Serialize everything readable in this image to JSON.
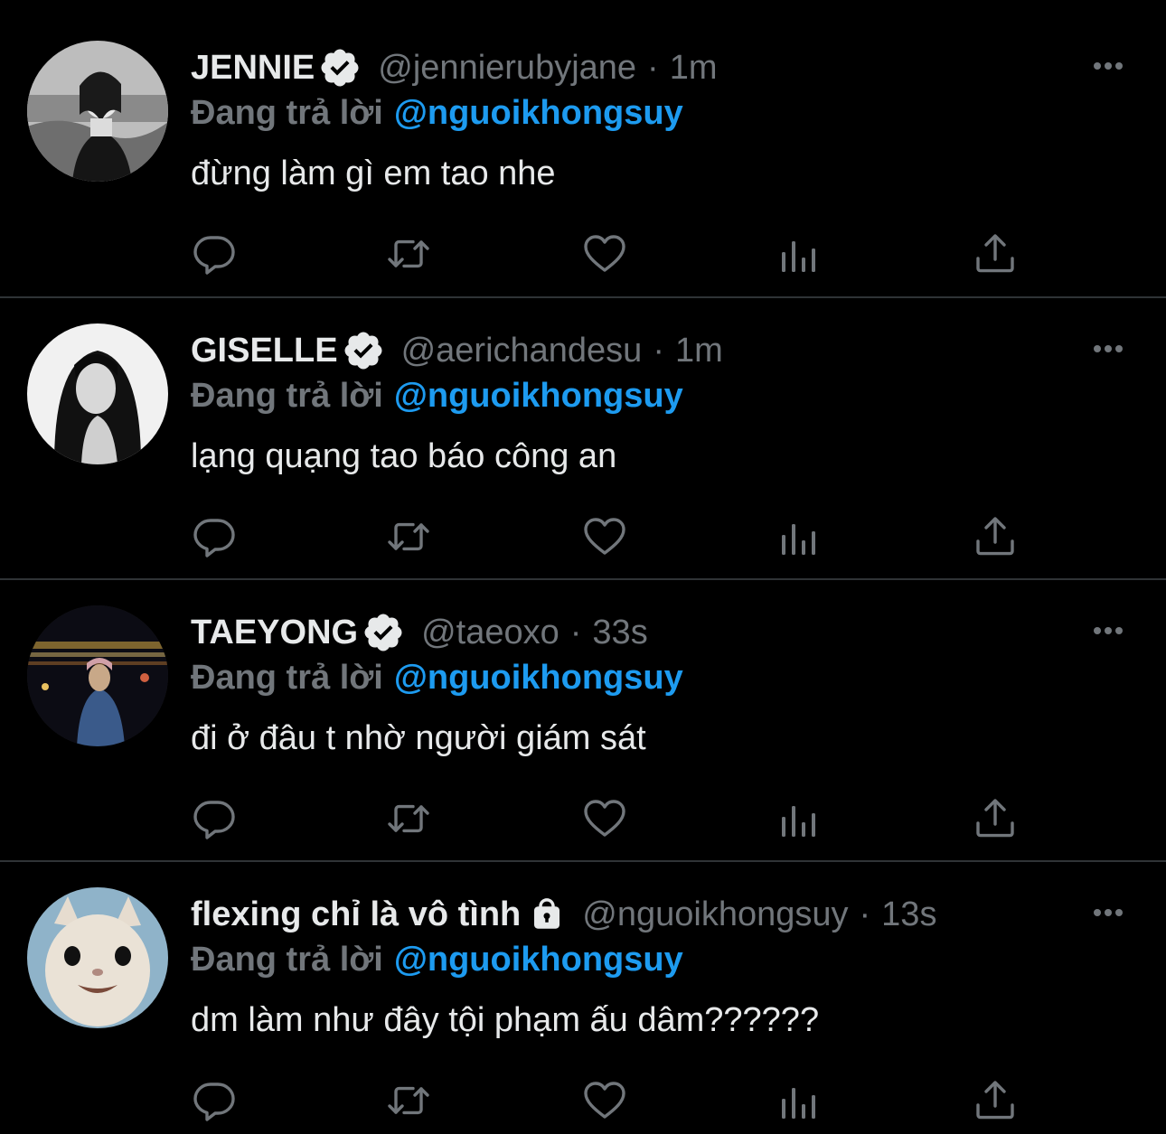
{
  "colors": {
    "background": "#000000",
    "primary_text": "#e7e9ea",
    "secondary_text": "#71767b",
    "mention": "#1d9bf0",
    "divider": "#2f3336",
    "verified_badge": "#e7e9ea"
  },
  "icons": {
    "reply": "reply-icon",
    "retweet": "retweet-icon",
    "like": "heart-icon",
    "views": "analytics-icon",
    "share": "share-icon",
    "more": "more-icon",
    "verified": "verified-icon",
    "protected": "lock-icon"
  },
  "tweets": [
    {
      "name": "JENNIE",
      "verified": true,
      "handle": "@jennierubyjane",
      "separator": "·",
      "time": "1m",
      "replying_label": "Đang trả lời",
      "replying_to": "@nguoikhongsuy",
      "text": "đừng làm gì em tao nhe"
    },
    {
      "name": "GISELLE",
      "verified": true,
      "handle": "@aerichandesu",
      "separator": "·",
      "time": "1m",
      "replying_label": "Đang trả lời",
      "replying_to": "@nguoikhongsuy",
      "text": "lạng quạng tao báo công an"
    },
    {
      "name": "TAEYONG",
      "verified": true,
      "handle": "@taeoxo",
      "separator": "·",
      "time": "33s",
      "replying_label": "Đang trả lời",
      "replying_to": "@nguoikhongsuy",
      "text": "đi ở đâu t nhờ người giám sát"
    },
    {
      "name": "flexing chỉ là vô tình",
      "protected": true,
      "handle": "@nguoikhongsuy",
      "separator": "·",
      "time": "13s",
      "replying_label": "Đang trả lời",
      "replying_to": "@nguoikhongsuy",
      "text": "dm làm như đây tội phạm ấu dâm??????"
    }
  ]
}
